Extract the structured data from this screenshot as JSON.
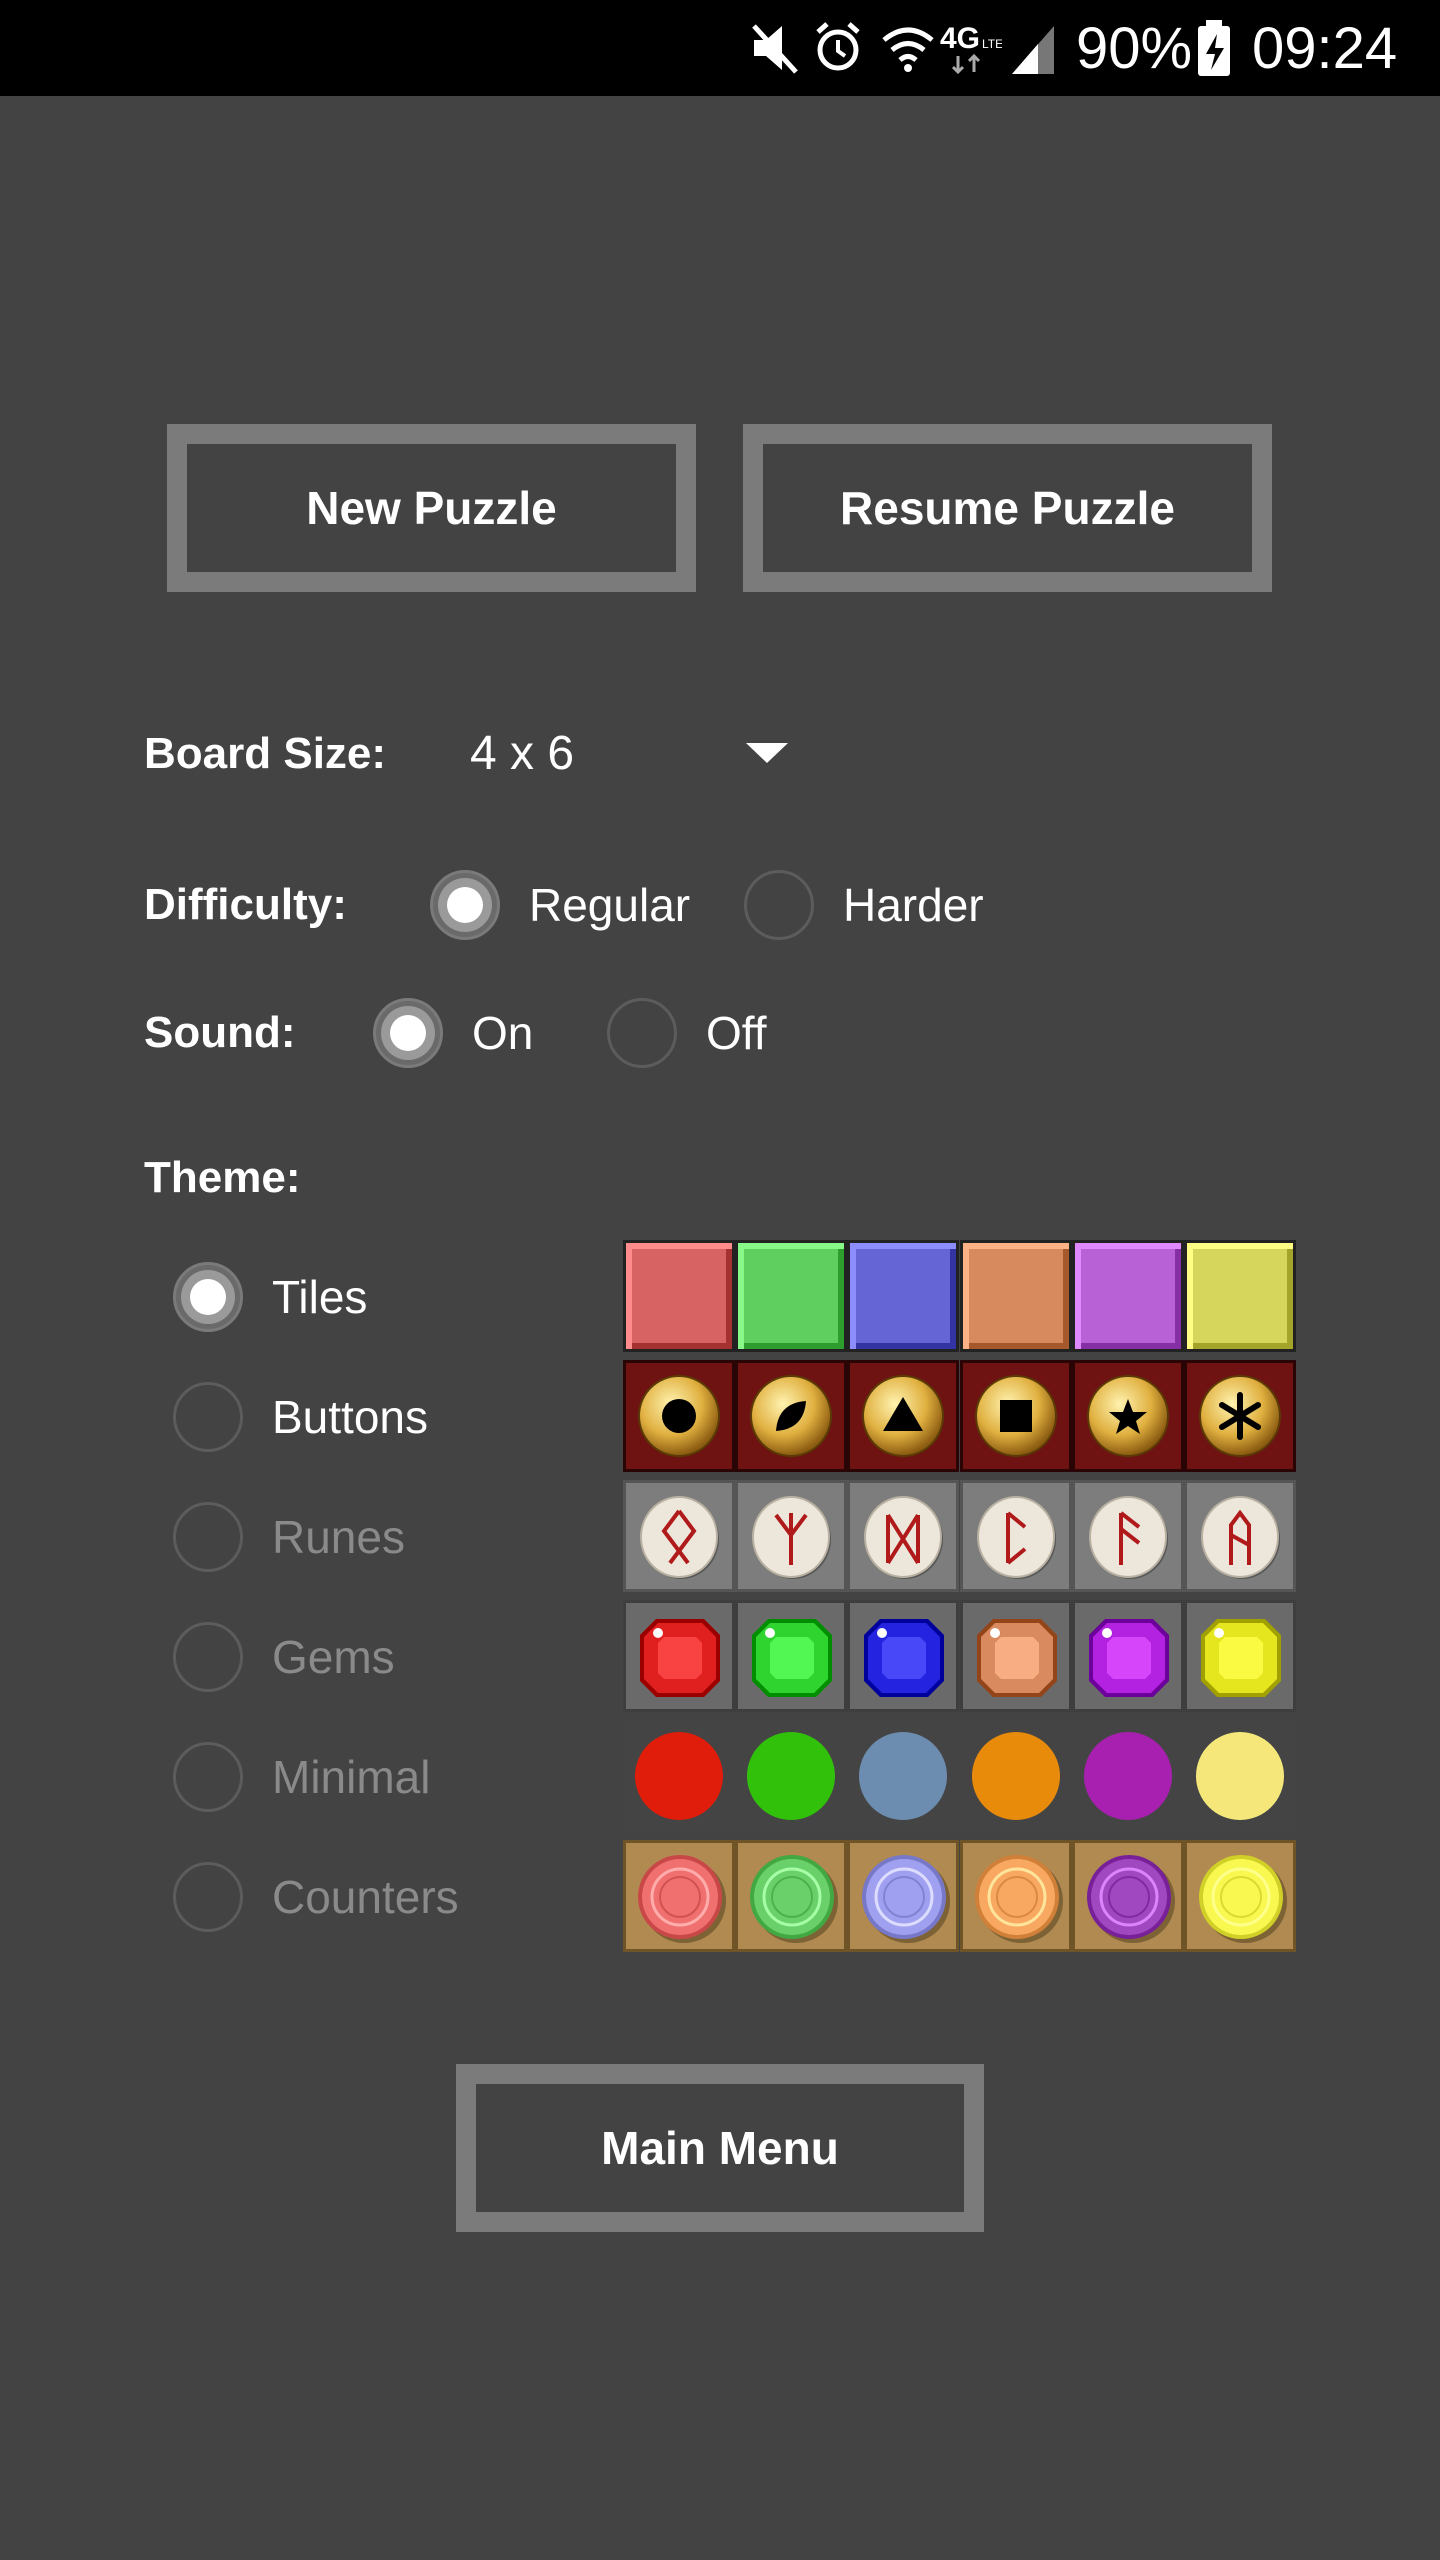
{
  "status_bar": {
    "battery_percent": "90%",
    "time": "09:24",
    "icons": [
      "mute-icon",
      "alarm-icon",
      "wifi-icon",
      "4g-lte-icon",
      "signal-icon",
      "battery-charging-icon"
    ]
  },
  "buttons": {
    "new_puzzle": "New Puzzle",
    "resume_puzzle": "Resume Puzzle",
    "main_menu": "Main Menu"
  },
  "board_size": {
    "label": "Board Size:",
    "value": "4 x 6"
  },
  "difficulty": {
    "label": "Difficulty:",
    "options": [
      {
        "label": "Regular",
        "selected": true
      },
      {
        "label": "Harder",
        "selected": false
      }
    ]
  },
  "sound": {
    "label": "Sound:",
    "options": [
      {
        "label": "On",
        "selected": true
      },
      {
        "label": "Off",
        "selected": false
      }
    ]
  },
  "theme": {
    "label": "Theme:",
    "options": [
      {
        "label": "Tiles",
        "selected": true,
        "enabled": true
      },
      {
        "label": "Buttons",
        "selected": false,
        "enabled": true
      },
      {
        "label": "Runes",
        "selected": false,
        "enabled": false
      },
      {
        "label": "Gems",
        "selected": false,
        "enabled": false
      },
      {
        "label": "Minimal",
        "selected": false,
        "enabled": false
      },
      {
        "label": "Counters",
        "selected": false,
        "enabled": false
      }
    ],
    "previews": {
      "tiles": [
        "#d86363",
        "#5fcf5f",
        "#6565d6",
        "#d78a5e",
        "#b860d6",
        "#d6d65c"
      ],
      "buttons": [
        "circle-icon",
        "leaf-icon",
        "triangle-icon",
        "square-icon",
        "star-icon",
        "asterisk-icon"
      ],
      "runes": [
        "othala-rune-icon",
        "algiz-rune-icon",
        "dagaz-rune-icon",
        "kaunan-rune-icon",
        "ansuz-rune-icon",
        "ar-rune-icon"
      ],
      "gems": [
        "#e01f1f",
        "#2fd42f",
        "#2424e0",
        "#d98a5e",
        "#b222e0",
        "#e6e61e"
      ],
      "minimal": [
        "#e01c0b",
        "#32c10b",
        "#6d8db0",
        "#e88a0a",
        "#a820b0",
        "#f6e77b"
      ],
      "counters": [
        "#f07070",
        "#6ad06a",
        "#a0a0f0",
        "#f8a860",
        "#a048c0",
        "#f8f850"
      ]
    }
  }
}
